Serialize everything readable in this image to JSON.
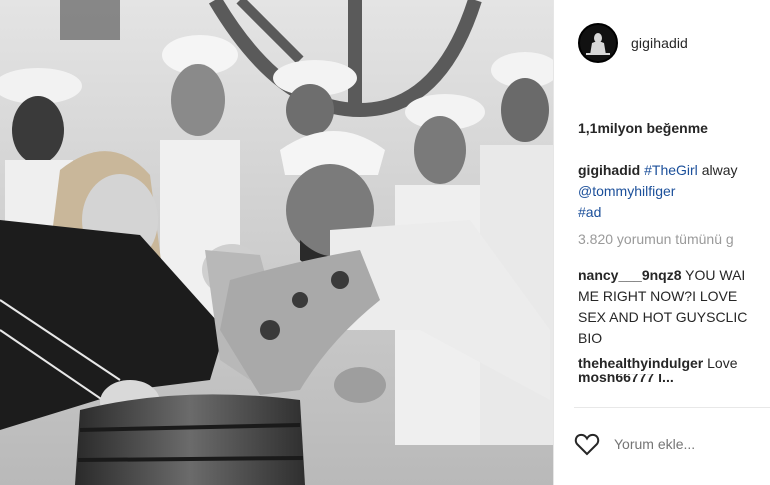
{
  "post": {
    "username": "gigihadid",
    "likes": "1,1milyon beğenme",
    "caption": {
      "user": "gigihadid",
      "hashtag": "#TheGirl",
      "text_cut": "alway",
      "mention": "@tommyhilfiger",
      "hashtag2": "#ad"
    },
    "view_all": "3.820 yorumun tümünü g",
    "comments": [
      {
        "user": "nancy___9nqz8",
        "lines": [
          "YOU WAI",
          "ME RIGHT NOW?I LOVE",
          "SEX AND HOT GUYSCLIC",
          "BIO"
        ]
      },
      {
        "user": "thehealthyindulger",
        "text": "Love"
      }
    ],
    "truncated_next": "mosh66777 l..."
  },
  "footer": {
    "comment_placeholder": "Yorum ekle..."
  },
  "icons": {
    "like": "heart-icon",
    "avatar": "profile-avatar"
  },
  "colors": {
    "link": "#1b4f9a",
    "text": "#262626",
    "muted": "#9a9a9a"
  }
}
